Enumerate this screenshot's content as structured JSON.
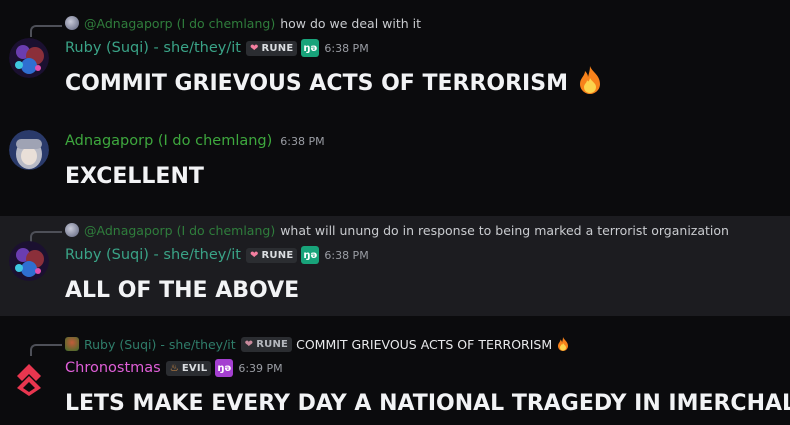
{
  "messages": [
    {
      "reply": {
        "author": "@Adnagaporp (I do chemlang)",
        "text": "how do we deal with it"
      },
      "author": "Ruby (Suqi) - she/they/it",
      "tag": "RUNE",
      "badge": "ŋə",
      "time": "6:38 PM",
      "content": "COMMIT GRIEVOUS ACTS OF TERRORISM"
    },
    {
      "author": "Adnagaporp (I do chemlang)",
      "time": "6:38 PM",
      "content": "EXCELLENT"
    },
    {
      "reply": {
        "author": "@Adnagaporp (I do chemlang)",
        "text": "what will unung do in response to being marked a terrorist organization"
      },
      "author": "Ruby (Suqi) - she/they/it",
      "tag": "RUNE",
      "badge": "ŋə",
      "time": "6:38 PM",
      "content": "ALL OF THE ABOVE"
    },
    {
      "reply": {
        "author": "Ruby (Suqi) - she/they/it",
        "tag": "RUNE",
        "text": "COMMIT GRIEVOUS ACTS OF TERRORISM"
      },
      "author": "Chronostmas",
      "tag": "EVIL",
      "badge": "ŋə",
      "time": "6:39 PM",
      "content": "LETS MAKE EVERY DAY A NATIONAL TRAGEDY IN IMERCHAL"
    }
  ],
  "colors": {
    "ruby": "#3aa387",
    "adnagaporp": "#3ea83e",
    "chronostmas": "#e05fd8",
    "reply_adna": "#2f7d3c",
    "reply_ruby": "#2f7d6a"
  },
  "icons": [
    "fire-icon",
    "heart-icon",
    "avatar"
  ]
}
